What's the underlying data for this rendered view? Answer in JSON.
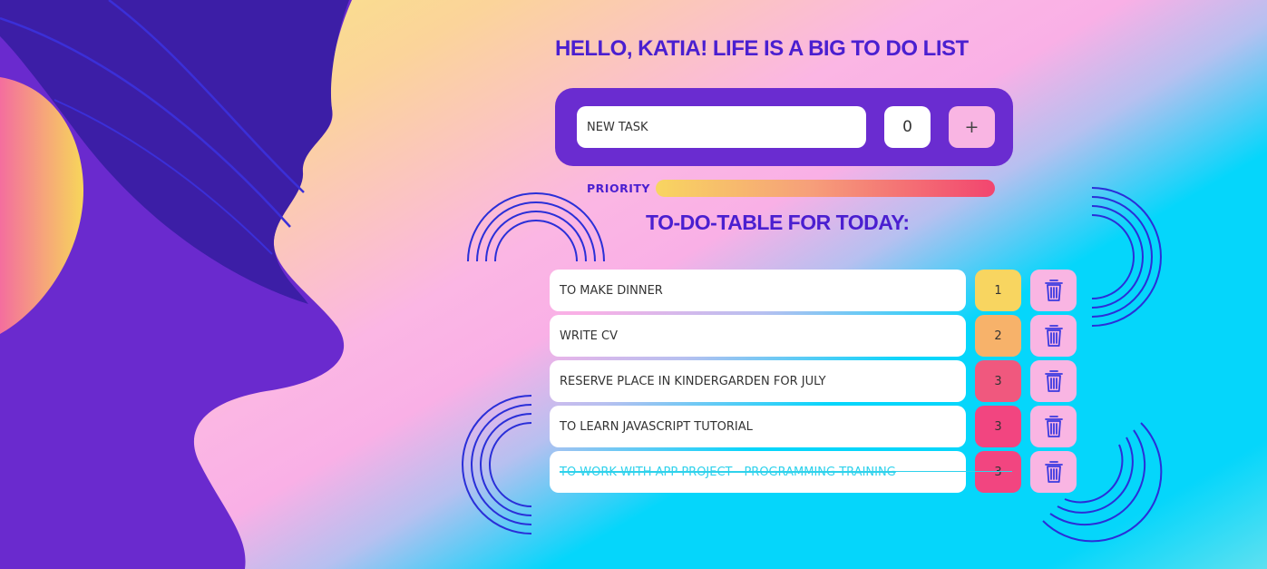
{
  "header": {
    "title": "HELLO, KATIA! LIFE IS A BIG TO DO LIST"
  },
  "new_task": {
    "placeholder": "NEW TASK",
    "priority_value": "0",
    "add_label": "+"
  },
  "priority_label": "PRIORITY",
  "table_title": "TO-DO-TABLE FOR TODAY:",
  "tasks": [
    {
      "text": "TO MAKE DINNER",
      "priority": "1",
      "done": false
    },
    {
      "text": "WRITE CV",
      "priority": "2",
      "done": false
    },
    {
      "text": "RESERVE PLACE IN KINDERGARDEN FOR JULY",
      "priority": "3",
      "done": false
    },
    {
      "text": "TO LEARN JAVASCRIPT TUTORIAL",
      "priority": "3",
      "done": false
    },
    {
      "text": "TO WORK WITH APP PROJECT - PROGRAMMING TRAINING",
      "priority": "3",
      "done": true
    }
  ],
  "colors": {
    "accent": "#4a1fd0",
    "panel": "#6a2cd0",
    "pink": "#f9b5e3",
    "priority_1": "#f8d560",
    "priority_2": "#f7b26a",
    "priority_3_a": "#f0587e",
    "priority_3_b": "#f24580",
    "done_text": "#2fd2ec"
  },
  "icons": {
    "delete": "trash-icon",
    "add": "plus-icon"
  }
}
